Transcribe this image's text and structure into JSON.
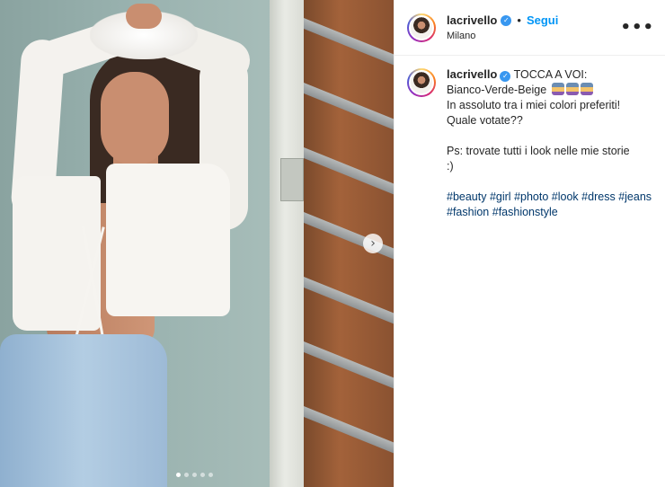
{
  "post": {
    "username": "lacrivello",
    "follow_label": "Segui",
    "separator": "•",
    "location": "Milano",
    "more_icon": "•••",
    "verified_icon": "✓",
    "next_icon": "›"
  },
  "caption": {
    "username": "lacrivello",
    "lines": [
      "TOCCA A VOI:",
      "Bianco-Verde-Beige",
      "In assoluto tra i miei colori preferiti!",
      "Quale votate??",
      "Ps: trovate tutti i look nelle mie storie",
      ":)"
    ],
    "emoji_count": 3,
    "hashtags": [
      "#beauty",
      "#girl",
      "#photo",
      "#look",
      "#dress",
      "#jeans",
      "#fashion",
      "#fashionstyle"
    ]
  },
  "carousel": {
    "total": 5,
    "active_index": 0
  },
  "colors": {
    "link": "#0095f6",
    "hashtag": "#00376b",
    "text": "#262626",
    "verified": "#3897f0"
  }
}
